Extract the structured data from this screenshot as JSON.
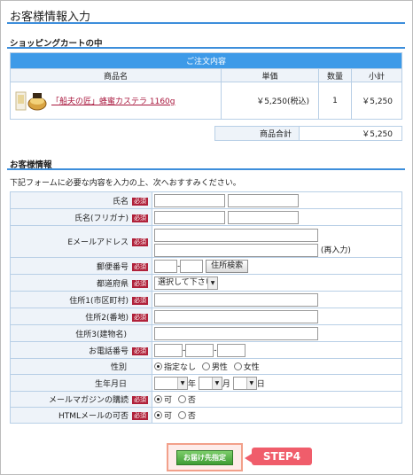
{
  "page": {
    "title": "お客様情報入力"
  },
  "cart": {
    "section_title": "ショッピングカートの中",
    "caption": "ご注文内容",
    "headers": [
      "商品名",
      "単価",
      "数量",
      "小計"
    ],
    "items": [
      {
        "name": "「船夫の匠」蜂蜜カステラ 1160g",
        "unit_price": "￥5,250(税込)",
        "qty": "1",
        "subtotal": "￥5,250"
      }
    ],
    "total_label": "商品合計",
    "total_value": "￥5,250"
  },
  "customer": {
    "section_title": "お客様情報",
    "intro": "下記フォームに必要な内容を入力の上、次へおすすみください。",
    "required_badge": "必須",
    "fields": {
      "name": "氏名",
      "kana": "氏名(フリガナ)",
      "email": "Eメールアドレス",
      "email_reinput": "(再入力)",
      "zip": "郵便番号",
      "zip_search": "住所検索",
      "pref": "都道府県",
      "pref_select": "選択して下さい",
      "addr1": "住所1(市区町村)",
      "addr2": "住所2(番地)",
      "addr3": "住所3(建物名)",
      "tel": "お電話番号",
      "gender": "性別",
      "gender_options": [
        "指定なし",
        "男性",
        "女性"
      ],
      "birth": "生年月日",
      "birth_units": [
        "年",
        "月",
        "日"
      ],
      "mailmag": "メールマガジンの購読",
      "html_mail": "HTMLメールの可否",
      "yes": "可",
      "no": "否"
    }
  },
  "submit": {
    "label": "お届け先指定",
    "step": "STEP4"
  },
  "colors": {
    "accent": "#3d8edb",
    "caption": "#3d9ae8",
    "required": "#b0213a",
    "step": "#f05d6b",
    "submit": "#3f9d35"
  }
}
